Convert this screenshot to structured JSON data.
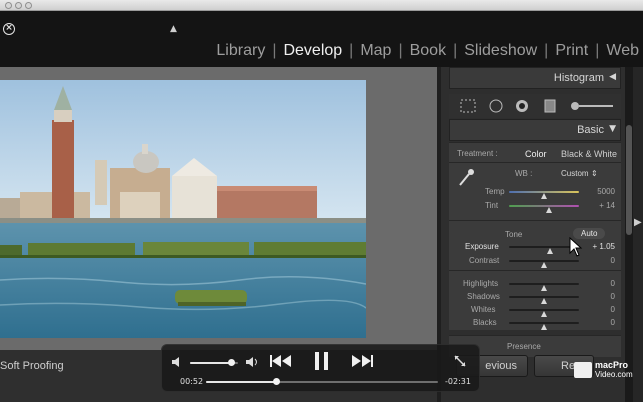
{
  "app": {
    "title_bar": "",
    "collapse_arrow": "▲",
    "modules": [
      {
        "label": "Library",
        "active": false
      },
      {
        "label": "Develop",
        "active": true
      },
      {
        "label": "Map",
        "active": false
      },
      {
        "label": "Book",
        "active": false
      },
      {
        "label": "Slideshow",
        "active": false
      },
      {
        "label": "Print",
        "active": false
      },
      {
        "label": "Web",
        "active": false
      }
    ]
  },
  "panel": {
    "histogram_title": "Histogram",
    "basic_title": "Basic",
    "treatment_label": "Treatment :",
    "treatment_color": "Color",
    "treatment_bw": "Black & White",
    "wb_label": "WB :",
    "wb_value": "Custom",
    "temp_label": "Temp",
    "temp_value": "5000",
    "tint_label": "Tint",
    "tint_value": "+ 14",
    "tone_label": "Tone",
    "auto_label": "Auto",
    "exposure_label": "Exposure",
    "exposure_value": "+ 1.05",
    "contrast_label": "Contrast",
    "contrast_value": "0",
    "highlights_label": "Highlights",
    "highlights_value": "0",
    "shadows_label": "Shadows",
    "shadows_value": "0",
    "whites_label": "Whites",
    "whites_value": "0",
    "blacks_label": "Blacks",
    "blacks_value": "0",
    "presence_label": "Presence",
    "sliders": {
      "temp": 0.5,
      "tint": 0.57,
      "exposure": 0.58,
      "contrast": 0.5,
      "highlights": 0.5,
      "shadows": 0.5,
      "whites": 0.5,
      "blacks": 0.5
    }
  },
  "toolbar": {
    "soft_proofing": "Soft Proofing",
    "previous_label": "Previous",
    "reset_label": "Reset",
    "previous_visible": "evious",
    "reset_visible": "Re"
  },
  "video": {
    "elapsed": "00:52",
    "remaining": "-02:31",
    "progress": 0.3,
    "volume": 0.85
  },
  "watermark": {
    "line1": "macPro",
    "line2": "Video.com"
  },
  "colors": {
    "accent": "#f0f0f0",
    "panel": "#3b3b3b",
    "background": "#262626"
  },
  "icons": [
    "close-icon",
    "collapse-up-icon",
    "crop-icon",
    "spot-removal-icon",
    "red-eye-icon",
    "graduated-filter-icon",
    "adjustment-brush-icon",
    "eyedropper-icon",
    "volume-low-icon",
    "volume-high-icon",
    "rewind-icon",
    "pause-icon",
    "fast-forward-icon",
    "fullscreen-icon",
    "macprovideo-logo"
  ]
}
